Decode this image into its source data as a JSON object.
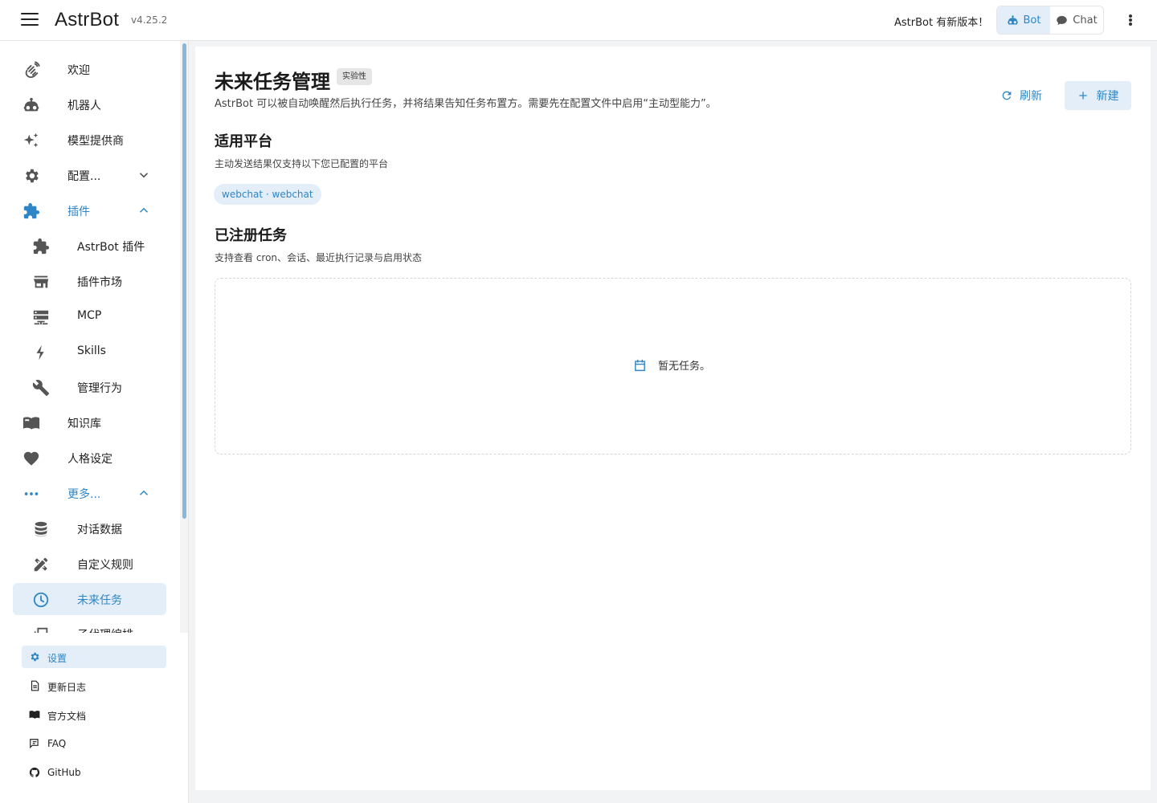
{
  "appbar": {
    "brand": "AstrBot",
    "version": "v4.25.2",
    "update_note": "AstrBot 有新版本！",
    "modes": [
      {
        "label": "Bot",
        "active": true
      },
      {
        "label": "Chat",
        "active": false
      }
    ]
  },
  "sidebar": {
    "items": [
      {
        "label": "欢迎",
        "icon": "waving-hand-icon"
      },
      {
        "label": "机器人",
        "icon": "robot-icon"
      },
      {
        "label": "模型提供商",
        "icon": "sparkles-icon"
      },
      {
        "label": "配置...",
        "icon": "gear-icon",
        "expandable": true,
        "expanded": false
      },
      {
        "label": "插件",
        "icon": "puzzle-icon",
        "expandable": true,
        "expanded": true
      },
      {
        "label": "AstrBot 插件",
        "icon": "puzzle-icon",
        "sub": true
      },
      {
        "label": "插件市场",
        "icon": "store-icon",
        "sub": true
      },
      {
        "label": "MCP",
        "icon": "server-icon",
        "sub": true
      },
      {
        "label": "Skills",
        "icon": "lightning-icon",
        "sub": true
      },
      {
        "label": "管理行为",
        "icon": "wrench-icon",
        "sub": true
      },
      {
        "label": "知识库",
        "icon": "book-icon"
      },
      {
        "label": "人格设定",
        "icon": "heart-icon"
      },
      {
        "label": "更多...",
        "icon": "dots-icon",
        "expandable": true,
        "expanded": true
      },
      {
        "label": "对话数据",
        "icon": "database-icon",
        "sub": true
      },
      {
        "label": "自定义规则",
        "icon": "pencil-ruler-icon",
        "sub": true
      },
      {
        "label": "未来任务",
        "icon": "clock-icon",
        "sub": true,
        "active": true
      },
      {
        "label": "子代理编排",
        "icon": "copy-icon",
        "sub": true
      }
    ],
    "footer": [
      {
        "label": "设置",
        "icon": "gear-icon",
        "active": true
      },
      {
        "label": "更新日志",
        "icon": "document-icon"
      },
      {
        "label": "官方文档",
        "icon": "book-icon"
      },
      {
        "label": "FAQ",
        "icon": "faq-icon"
      },
      {
        "label": "GitHub",
        "icon": "github-icon"
      }
    ]
  },
  "main": {
    "title": "未来任务管理",
    "badge": "实验性",
    "description": "AstrBot 可以被自动唤醒然后执行任务，并将结果告知任务布置方。需要先在配置文件中启用“主动型能力”。",
    "refresh_label": "刷新",
    "new_label": "新建",
    "platforms": {
      "title": "适用平台",
      "description": "主动发送结果仅支持以下您已配置的平台",
      "chips": [
        "webchat · webchat"
      ]
    },
    "tasks": {
      "title": "已注册任务",
      "description": "支持查看 cron、会话、最近执行记录与启用状态",
      "empty_text": "暂无任务。"
    }
  },
  "colors": {
    "accent": "#2f86c6",
    "accent_bg": "#e3eef8",
    "icon_gray": "#555555"
  }
}
